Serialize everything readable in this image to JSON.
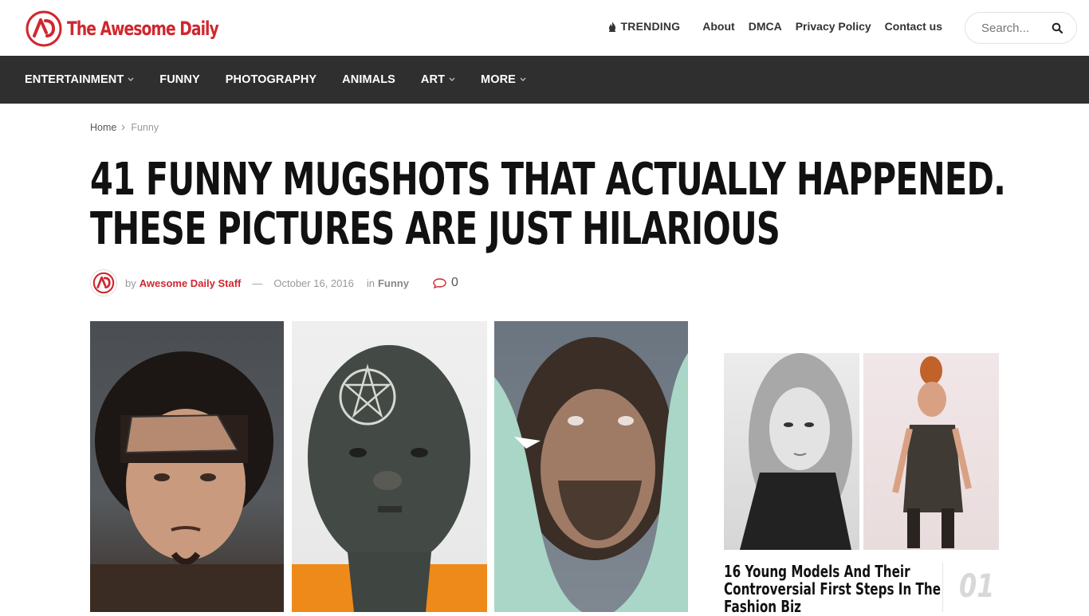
{
  "brand": {
    "name": "The Awesome Daily",
    "color": "#d0272f"
  },
  "topnav": {
    "trending": "TRENDING",
    "links": [
      "About",
      "DMCA",
      "Privacy Policy",
      "Contact us"
    ]
  },
  "search": {
    "placeholder": "Search..."
  },
  "mainnav": {
    "items": [
      {
        "label": "ENTERTAINMENT",
        "dropdown": true
      },
      {
        "label": "FUNNY",
        "dropdown": false
      },
      {
        "label": "PHOTOGRAPHY",
        "dropdown": false
      },
      {
        "label": "ANIMALS",
        "dropdown": false
      },
      {
        "label": "ART",
        "dropdown": true
      },
      {
        "label": "MORE",
        "dropdown": true
      }
    ]
  },
  "breadcrumb": {
    "home": "Home",
    "current": "Funny"
  },
  "article": {
    "title_line1": "41 FUNNY MUGSHOTS THAT ACTUALLY HAPPENED.",
    "title_line2": "THESE PICTURES ARE JUST HILARIOUS",
    "by": "by",
    "author": "Awesome Daily Staff",
    "dash": "—",
    "date": "October 16, 2016",
    "in": "in",
    "category": "Funny",
    "comments": "0"
  },
  "sidebar": {
    "title_line1": "16 Young Models And Their",
    "title_line2": "Controversial First Steps In The",
    "title_line3": "Fashion Biz",
    "number": "01"
  }
}
